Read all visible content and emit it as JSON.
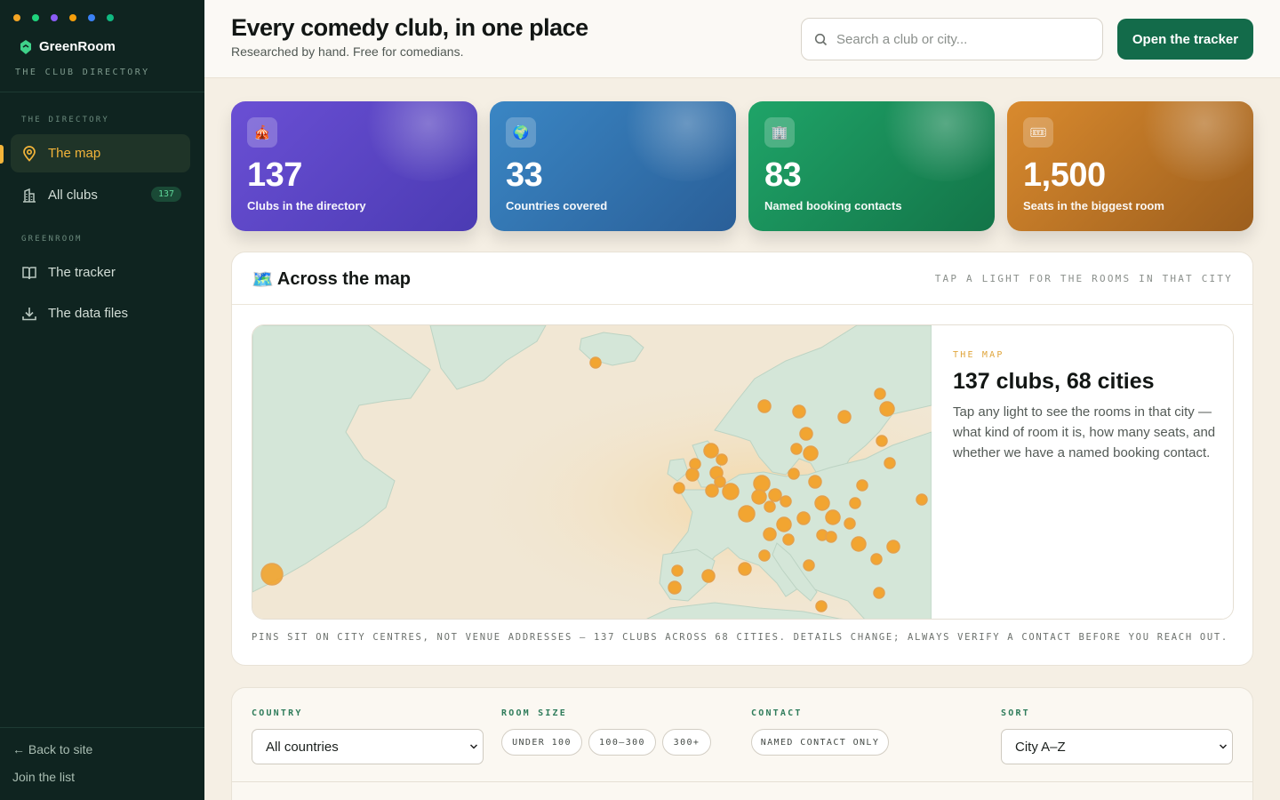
{
  "sidebar": {
    "dot_colors": [
      "#f5a524",
      "#1fd37c",
      "#8b5cf6",
      "#f59e0b",
      "#3b82f6",
      "#10b981"
    ],
    "brand": "GreenRoom",
    "brand_sub": "THE CLUB DIRECTORY",
    "section_directory": "THE DIRECTORY",
    "section_greenroom": "GREENROOM",
    "items": [
      {
        "label": "The map",
        "icon": "map-pin-icon",
        "active": true
      },
      {
        "label": "All clubs",
        "icon": "building-icon",
        "badge": "137"
      },
      {
        "label": "The tracker",
        "icon": "book-icon"
      },
      {
        "label": "The data files",
        "icon": "download-icon"
      }
    ],
    "back_link": "← Back to site",
    "join_link": "Join the list"
  },
  "header": {
    "title": "Every comedy club, in one place",
    "subtitle": "Researched by hand. Free for comedians.",
    "search_placeholder": "Search a club or city...",
    "cta": "Open the tracker"
  },
  "stats": [
    {
      "emoji": "🎪",
      "value": "137",
      "label": "Clubs in the directory",
      "color": "#5b45c9"
    },
    {
      "emoji": "🌍",
      "value": "33",
      "label": "Countries covered",
      "color": "#2f6fae"
    },
    {
      "emoji": "🏢",
      "value": "83",
      "label": "Named booking contacts",
      "color": "#16875a"
    },
    {
      "emoji": "🎟",
      "value": "1,500",
      "label": "Seats in the biggest room",
      "color": "#c77b25"
    }
  ],
  "map_panel": {
    "title_emoji": "🗺️",
    "title": "Across the map",
    "hint": "TAP A LIGHT FOR THE ROOMS IN THAT CITY",
    "info_eyebrow": "THE MAP",
    "info_title": "137 clubs, 68 cities",
    "info_text": "Tap any light to see the rooms in that city — what kind of room it is, how many seats, and whether we have a named booking contact.",
    "note": "PINS SIT ON CITY CENTRES, NOT VENUE ADDRESSES — 137 CLUBS ACROSS 68 CITIES. DETAILS CHANGE; ALWAYS VERIFY A CONTACT BEFORE YOU REACH OUT.",
    "land_color": "#d4e6d8",
    "pin_color": "#f2a531"
  },
  "filters": {
    "country_label": "COUNTRY",
    "country_value": "All countries",
    "room_size_label": "ROOM SIZE",
    "room_sizes": [
      "UNDER 100",
      "100–300",
      "300+"
    ],
    "contact_label": "CONTACT",
    "contact_chip": "NAMED CONTACT ONLY",
    "sort_label": "SORT",
    "sort_value": "City A–Z"
  }
}
